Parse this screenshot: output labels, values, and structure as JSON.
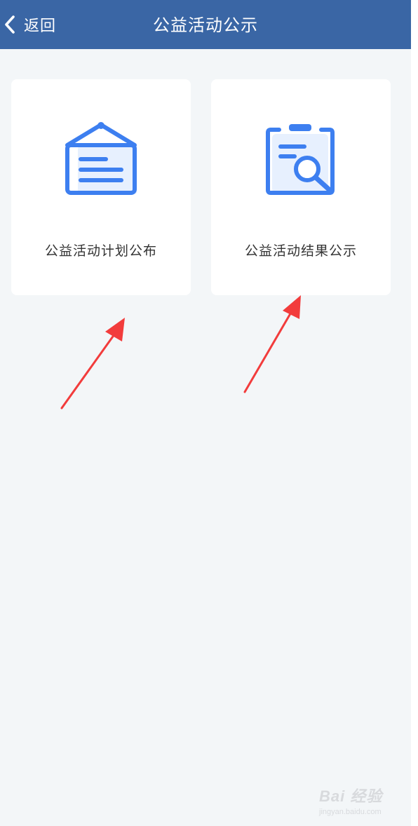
{
  "header": {
    "back_label": "返回",
    "title": "公益活动公示"
  },
  "cards": [
    {
      "label": "公益活动计划公布",
      "icon": "noticeboard-icon"
    },
    {
      "label": "公益活动结果公示",
      "icon": "clipboard-search-icon"
    }
  ],
  "watermark": {
    "main": "Bai 经验",
    "sub": "jingyan.baidu.com"
  },
  "colors": {
    "navbar": "#3a66a5",
    "background": "#f3f6f8",
    "icon_blue": "#3d7ff0",
    "arrow_red": "#f23c3c"
  }
}
